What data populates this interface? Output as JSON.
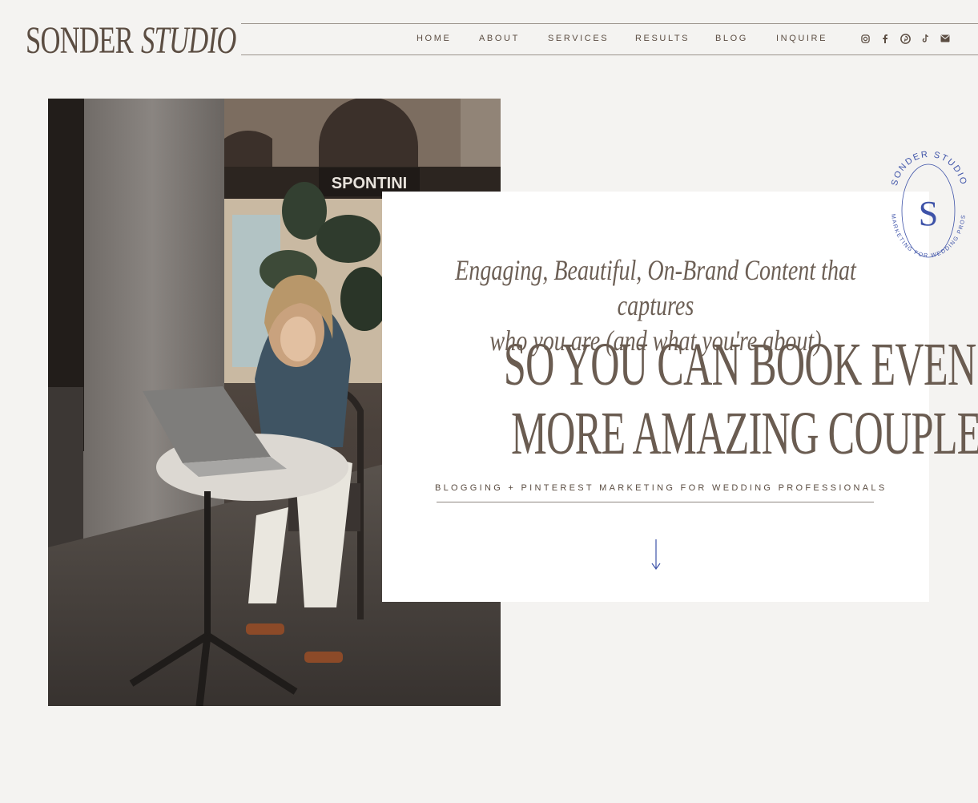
{
  "brand": {
    "logo_part1": "SONDER",
    "logo_part2": "STUDIO"
  },
  "nav": {
    "items": [
      "HOME",
      "ABOUT",
      "SERVICES",
      "RESULTS",
      "BLOG",
      "INQUIRE"
    ]
  },
  "social_icons": [
    "instagram-icon",
    "facebook-icon",
    "pinterest-icon",
    "tiktok-icon",
    "email-icon"
  ],
  "hero": {
    "tagline_line1": "Engaging, Beautiful, On-Brand Content that captures",
    "tagline_line2": "who you are (and what you're about)",
    "headline_line1": "SO YOU CAN BOOK EVEN",
    "headline_line2": "MORE AMAZING COUPLES.",
    "subtitle": "BLOGGING + PINTEREST MARKETING FOR WEDDING PROFESSIONALS"
  },
  "badge": {
    "top_text": "SONDER STUDIO",
    "bottom_text": "MARKETING FOR WEDDING PROS",
    "monogram": "S"
  },
  "photo_sign": "SPONTINI",
  "colors": {
    "background": "#f4f3f1",
    "text": "#5f5247",
    "accent": "#3d52a8",
    "card": "#ffffff"
  }
}
